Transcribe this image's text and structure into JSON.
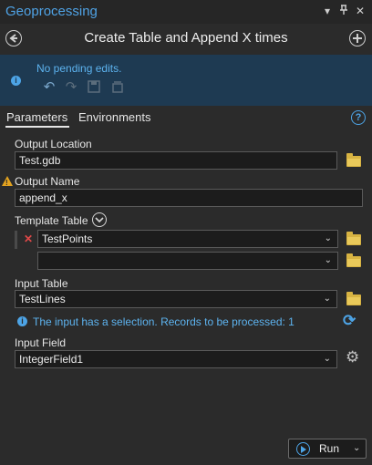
{
  "window": {
    "title": "Geoprocessing",
    "controls": [
      "▾",
      "⊤",
      "✕"
    ]
  },
  "tool": {
    "title": "Create Table and Append X times",
    "back_icon": "back-circle-icon",
    "add_icon": "add-circle-icon"
  },
  "edits": {
    "status": "No pending edits."
  },
  "tabs": [
    {
      "label": "Parameters",
      "active": true
    },
    {
      "label": "Environments",
      "active": false
    }
  ],
  "params": {
    "output_location": {
      "label": "Output Location",
      "value": "Test.gdb"
    },
    "output_name": {
      "label": "Output Name",
      "value": "append_x"
    },
    "template_table": {
      "label": "Template Table",
      "values": [
        "TestPoints",
        ""
      ]
    },
    "input_table": {
      "label": "Input Table",
      "value": "TestLines"
    },
    "selection_message": "The input has a selection. Records to be processed: 1",
    "input_field": {
      "label": "Input Field",
      "value": "IntegerField1"
    }
  },
  "run": {
    "label": "Run"
  },
  "colors": {
    "accent": "#4da4e6",
    "warning": "#e4a31f",
    "remove": "#e04848"
  }
}
